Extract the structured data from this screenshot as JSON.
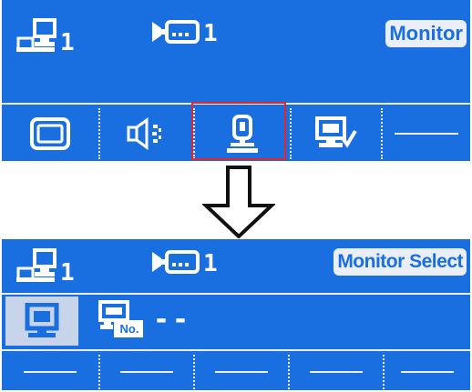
{
  "before": {
    "status": {
      "monitor_count": "1",
      "camera_count": "1"
    },
    "mode_label": "Monitor",
    "toolbar": [
      {
        "icon": "display-icon",
        "selected": false
      },
      {
        "icon": "speaker-icon",
        "selected": false
      },
      {
        "icon": "joystick-icon",
        "selected": true
      },
      {
        "icon": "monitor-check-icon",
        "selected": false
      },
      {
        "icon": "empty-dash",
        "selected": false
      }
    ]
  },
  "after": {
    "status": {
      "monitor_count": "1",
      "camera_count": "1"
    },
    "mode_label": "Monitor Select",
    "monitor_number_label": "No.",
    "monitor_number_value": "--",
    "bottom_slots": [
      "",
      "",
      "",
      "",
      ""
    ]
  },
  "colors": {
    "screen_bg": "#1a6fe0",
    "foreground": "#e9eef8",
    "highlight_border": "#e3262b",
    "selected_cell": "#c8d4ea"
  }
}
